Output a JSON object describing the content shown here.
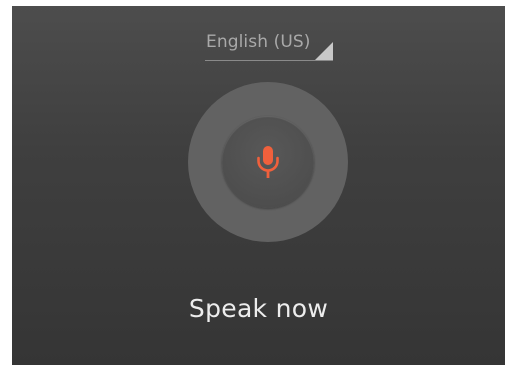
{
  "language_selector": {
    "label": "English (US)"
  },
  "mic": {
    "icon": "microphone-icon",
    "color": "#f0603c"
  },
  "prompt": {
    "text": "Speak now"
  },
  "colors": {
    "background_top": "#4d4d4d",
    "background_bottom": "#353535",
    "accent": "#f0603c"
  }
}
